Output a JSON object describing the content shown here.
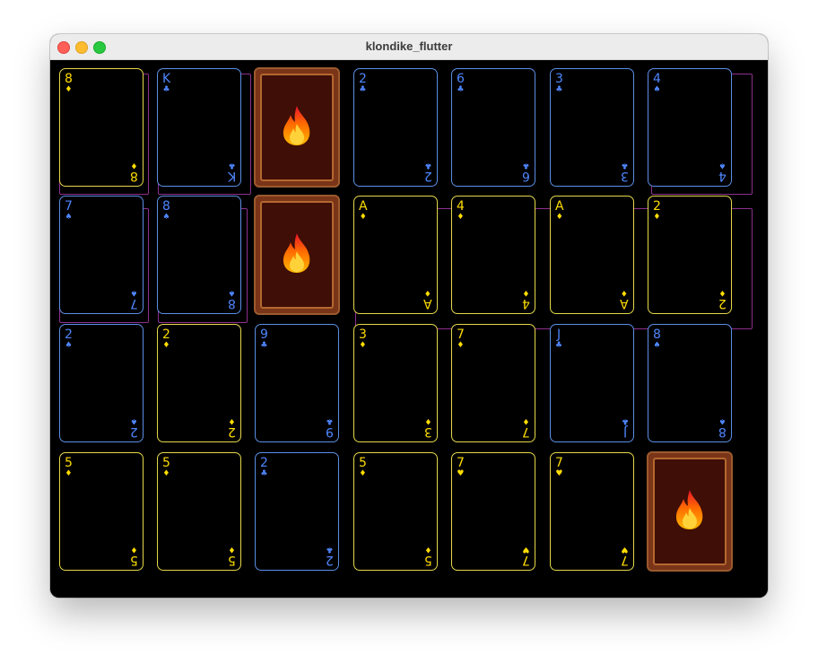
{
  "window": {
    "title": "klondike_flutter"
  },
  "colors": {
    "yellow": "#ffdd00",
    "blue": "#4f86ff",
    "back": "#3f0e07",
    "outline": "#8e2f8e"
  },
  "suit_glyphs": {
    "diamond": "♦",
    "club": "♣",
    "spade": "♠",
    "heart": "♥"
  },
  "grid": [
    [
      {
        "rank": "8",
        "suit": "diamond",
        "color": "yellow"
      },
      {
        "rank": "K",
        "suit": "club",
        "color": "blue"
      },
      {
        "face_down": true,
        "icon": "fire-icon"
      },
      {
        "rank": "2",
        "suit": "club",
        "color": "blue"
      },
      {
        "rank": "6",
        "suit": "club",
        "color": "blue"
      },
      {
        "rank": "3",
        "suit": "club",
        "color": "blue"
      },
      {
        "rank": "4",
        "suit": "spade",
        "color": "blue"
      }
    ],
    [
      {
        "rank": "7",
        "suit": "spade",
        "color": "blue"
      },
      {
        "rank": "8",
        "suit": "spade",
        "color": "blue"
      },
      {
        "face_down": true,
        "icon": "fire-icon"
      },
      {
        "rank": "A",
        "suit": "diamond",
        "color": "yellow"
      },
      {
        "rank": "4",
        "suit": "diamond",
        "color": "yellow"
      },
      {
        "rank": "A",
        "suit": "diamond",
        "color": "yellow"
      },
      {
        "rank": "2",
        "suit": "diamond",
        "color": "yellow"
      }
    ],
    [
      {
        "rank": "2",
        "suit": "spade",
        "color": "blue"
      },
      {
        "rank": "2",
        "suit": "diamond",
        "color": "yellow"
      },
      {
        "rank": "9",
        "suit": "club",
        "color": "blue"
      },
      {
        "rank": "3",
        "suit": "diamond",
        "color": "yellow"
      },
      {
        "rank": "7",
        "suit": "diamond",
        "color": "yellow"
      },
      {
        "rank": "J",
        "suit": "club",
        "color": "blue"
      },
      {
        "rank": "8",
        "suit": "spade",
        "color": "blue"
      }
    ],
    [
      {
        "rank": "5",
        "suit": "diamond",
        "color": "yellow"
      },
      {
        "rank": "5",
        "suit": "diamond",
        "color": "yellow"
      },
      {
        "rank": "2",
        "suit": "club",
        "color": "blue"
      },
      {
        "rank": "5",
        "suit": "diamond",
        "color": "yellow"
      },
      {
        "rank": "7",
        "suit": "heart",
        "color": "yellow"
      },
      {
        "rank": "7",
        "suit": "heart",
        "color": "yellow"
      },
      {
        "face_down": true,
        "icon": "fire-icon"
      }
    ]
  ]
}
